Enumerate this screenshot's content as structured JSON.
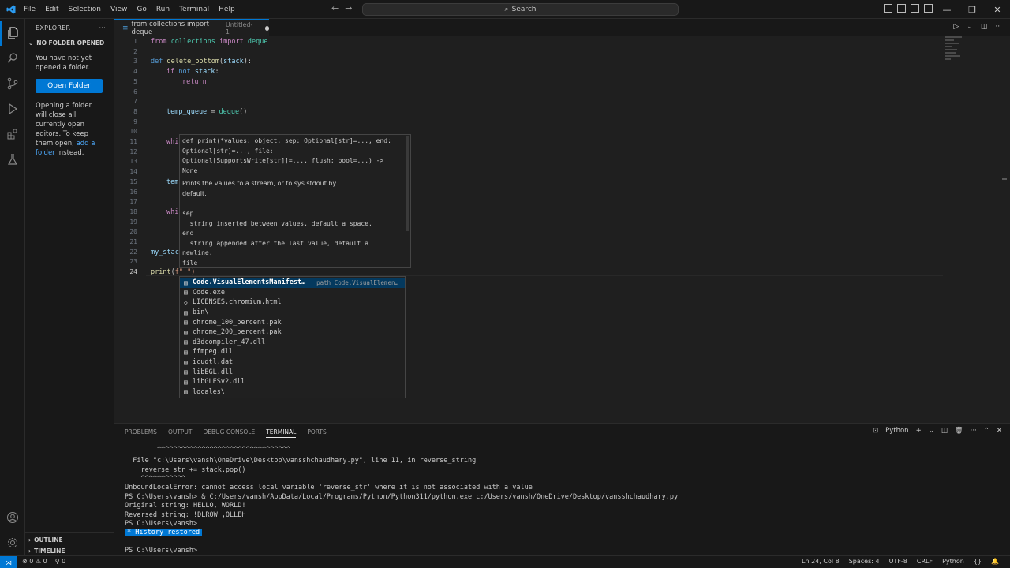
{
  "menu": [
    "File",
    "Edit",
    "Selection",
    "View",
    "Go",
    "Run",
    "Terminal",
    "Help"
  ],
  "search": {
    "label": "Search"
  },
  "explorer": {
    "title": "EXPLORER",
    "section": "NO FOLDER OPENED",
    "message1": "You have not yet opened a folder.",
    "open_folder_label": "Open Folder",
    "message2_part1": "Opening a folder will close all currently open editors. To keep them open, ",
    "message2_link": "add a folder",
    "message2_part2": " instead.",
    "outline_label": "OUTLINE",
    "timeline_label": "TIMELINE"
  },
  "tab": {
    "title": "from collections import deque",
    "subtitle": "Untitled-1"
  },
  "editor": {
    "line_numbers": [
      "1",
      "2",
      "3",
      "4",
      "5",
      "6",
      "7",
      "8",
      "9",
      "10",
      "11",
      "12",
      "13",
      "14",
      "15",
      "16",
      "17",
      "18",
      "19",
      "20",
      "21",
      "22",
      "23",
      "24"
    ],
    "code": {
      "l1_kw": "from",
      "l1_mod": "collections",
      "l1_kw2": "import",
      "l1_cls": "deque",
      "l3_kw": "def",
      "l3_fn": "delete_bottom",
      "l3_param": "stack",
      "l4_kw": "if",
      "l4_not": "not",
      "l4_var": "stack",
      "l5_kw": "return",
      "l8_var": "temp_queue",
      "l8_cls": "deque",
      "l11": "whi",
      "l15": "tem",
      "l18": "whi",
      "l22": "my_stac",
      "l24_fn": "print",
      "l24_str": "f\"|\")"
    }
  },
  "hover": {
    "lines": [
      "def print(*values: object, sep: Optional[str]=..., end:",
      "Optional[str]=..., file:",
      "Optional[SupportsWrite[str]]=..., flush: bool=...) ->",
      "None",
      "Prints the values to a stream, or to sys.stdout by",
      "default.",
      "sep",
      "  string inserted between values, default a space.",
      "end",
      "  string appended after the last value, default a",
      "newline.",
      "file"
    ]
  },
  "suggest": {
    "items": [
      {
        "label": "Code.VisualElementsManifest…",
        "detail": "path Code.VisualElemen…",
        "icon": "file-icon"
      },
      {
        "label": "Code.exe",
        "icon": "file-icon"
      },
      {
        "label": "LICENSES.chromium.html",
        "icon": "html-icon"
      },
      {
        "label": "bin\\",
        "icon": "file-icon"
      },
      {
        "label": "chrome_100_percent.pak",
        "icon": "file-icon"
      },
      {
        "label": "chrome_200_percent.pak",
        "icon": "file-icon"
      },
      {
        "label": "d3dcompiler_47.dll",
        "icon": "file-icon"
      },
      {
        "label": "ffmpeg.dll",
        "icon": "file-icon"
      },
      {
        "label": "icudtl.dat",
        "icon": "file-icon"
      },
      {
        "label": "libEGL.dll",
        "icon": "file-icon"
      },
      {
        "label": "libGLESv2.dll",
        "icon": "file-icon"
      },
      {
        "label": "locales\\",
        "icon": "file-icon"
      }
    ]
  },
  "panel": {
    "tabs": [
      "PROBLEMS",
      "OUTPUT",
      "DEBUG CONSOLE",
      "TERMINAL",
      "PORTS"
    ],
    "active_tab": "TERMINAL",
    "shell_label": "Python",
    "terminal_lines": [
      "        ^^^^^^^^^^^^^^^^^^^^^^^^^^^^^^^^^",
      "  File \"c:\\Users\\vansh\\OneDrive\\Desktop\\vansshchaudhary.py\", line 11, in reverse_string",
      "    reverse_str += stack.pop()",
      "    ^^^^^^^^^^^",
      "UnboundLocalError: cannot access local variable 'reverse_str' where it is not associated with a value",
      "PS C:\\Users\\vansh> & C:/Users/vansh/AppData/Local/Programs/Python/Python311/python.exe c:/Users/vansh/OneDrive/Desktop/vansshchaudhary.py",
      "Original string: HELLO, WORLD!",
      "Reversed string: !DLROW ,OLLEH",
      "PS C:\\Users\\vansh>",
      "PS C:\\Users\\vansh>"
    ],
    "history_restored": "History restored"
  },
  "statusbar": {
    "errors": "0",
    "warnings": "0",
    "ports": "0",
    "position": "Ln 24, Col 8",
    "spaces": "Spaces: 4",
    "encoding": "UTF-8",
    "eol": "CRLF",
    "language": "Python"
  },
  "colors": {
    "accent": "#0078d4",
    "background": "#1f1f1f",
    "sidebar": "#181818"
  }
}
